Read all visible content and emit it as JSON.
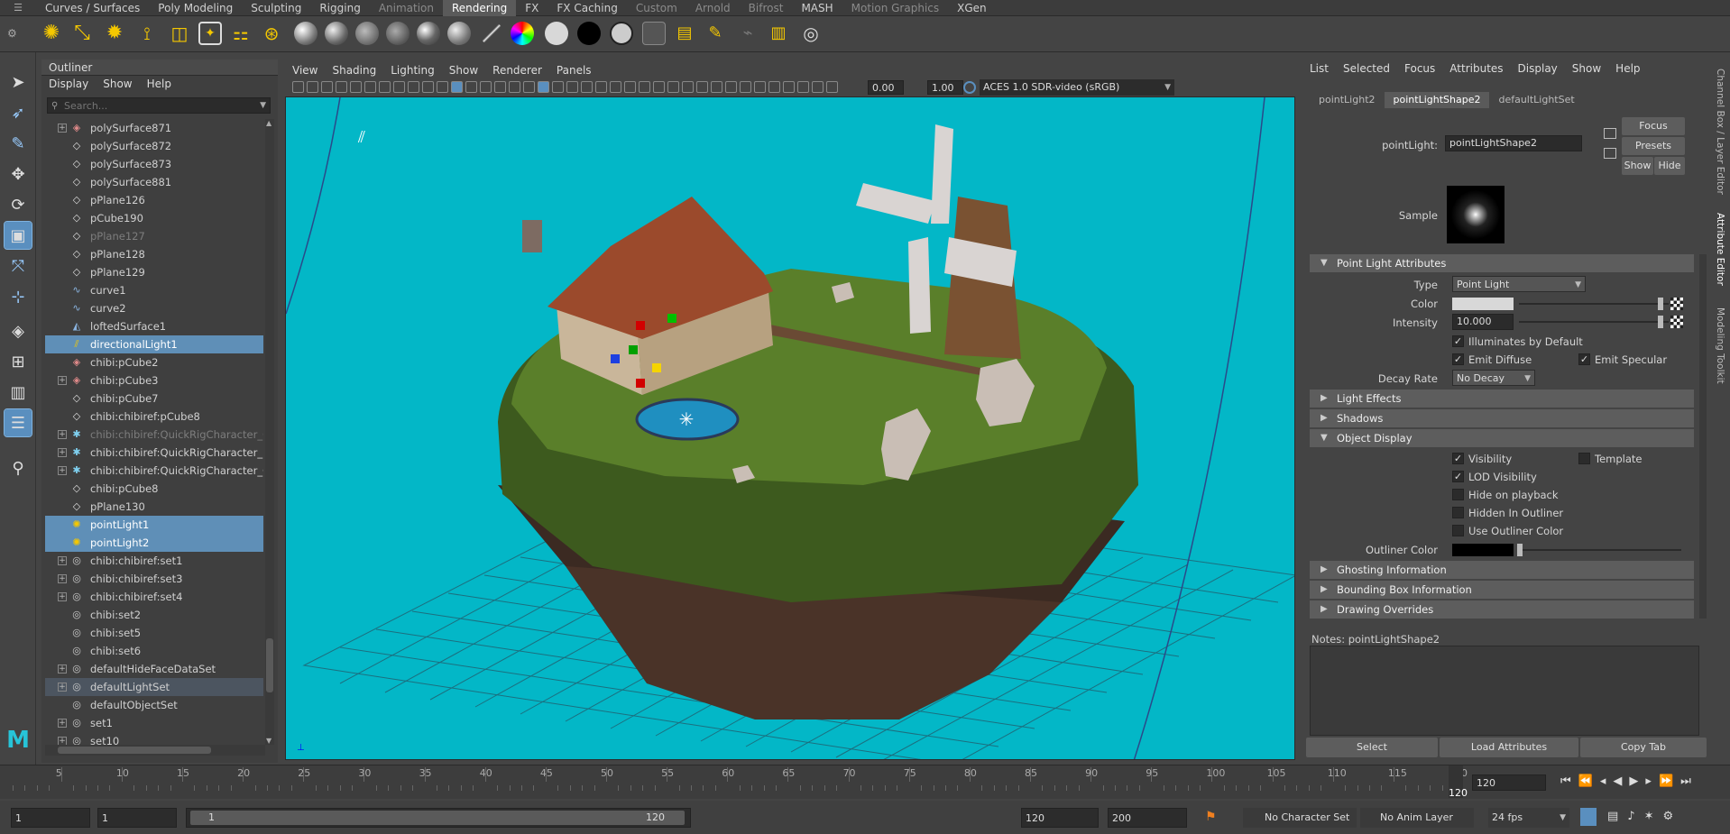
{
  "shelf": {
    "tabs": [
      {
        "label": "Curves / Surfaces",
        "dim": false
      },
      {
        "label": "Poly Modeling",
        "dim": false
      },
      {
        "label": "Sculpting",
        "dim": false
      },
      {
        "label": "Rigging",
        "dim": false
      },
      {
        "label": "Animation",
        "dim": true
      },
      {
        "label": "Rendering",
        "dim": false,
        "active": true
      },
      {
        "label": "FX",
        "dim": false
      },
      {
        "label": "FX Caching",
        "dim": false
      },
      {
        "label": "Custom",
        "dim": true
      },
      {
        "label": "Arnold",
        "dim": true
      },
      {
        "label": "Bifrost",
        "dim": true
      },
      {
        "label": "MASH",
        "dim": false
      },
      {
        "label": "Motion Graphics",
        "dim": true
      },
      {
        "label": "XGen",
        "dim": false
      }
    ]
  },
  "outliner": {
    "title": "Outliner",
    "menus": [
      "Display",
      "Show",
      "Help"
    ],
    "search_placeholder": "Search...",
    "rows": [
      {
        "label": "polySurface871",
        "icon": "poly",
        "expand": true,
        "state": ""
      },
      {
        "label": "polySurface872",
        "icon": "mesh",
        "expand": false,
        "state": ""
      },
      {
        "label": "polySurface873",
        "icon": "mesh",
        "expand": false,
        "state": ""
      },
      {
        "label": "polySurface881",
        "icon": "mesh",
        "expand": false,
        "state": ""
      },
      {
        "label": "pPlane126",
        "icon": "mesh",
        "expand": false,
        "state": ""
      },
      {
        "label": "pCube190",
        "icon": "mesh",
        "expand": false,
        "state": ""
      },
      {
        "label": "pPlane127",
        "icon": "mesh",
        "expand": false,
        "state": "dim"
      },
      {
        "label": "pPlane128",
        "icon": "mesh",
        "expand": false,
        "state": ""
      },
      {
        "label": "pPlane129",
        "icon": "mesh",
        "expand": false,
        "state": ""
      },
      {
        "label": "curve1",
        "icon": "curve",
        "expand": false,
        "state": ""
      },
      {
        "label": "curve2",
        "icon": "curve",
        "expand": false,
        "state": ""
      },
      {
        "label": "loftedSurface1",
        "icon": "surface",
        "expand": false,
        "state": ""
      },
      {
        "label": "directionalLight1",
        "icon": "dirlight",
        "expand": false,
        "state": "sel"
      },
      {
        "label": "chibi:pCube2",
        "icon": "poly",
        "expand": false,
        "state": ""
      },
      {
        "label": "chibi:pCube3",
        "icon": "poly",
        "expand": true,
        "state": ""
      },
      {
        "label": "chibi:pCube7",
        "icon": "mesh",
        "expand": false,
        "state": ""
      },
      {
        "label": "chibi:chibiref:pCube8",
        "icon": "mesh",
        "expand": false,
        "state": ""
      },
      {
        "label": "chibi:chibiref:QuickRigCharacter_Guid",
        "icon": "joint",
        "expand": true,
        "state": "dim"
      },
      {
        "label": "chibi:chibiref:QuickRigCharacter_Refe",
        "icon": "joint",
        "expand": true,
        "state": ""
      },
      {
        "label": "chibi:chibiref:QuickRigCharacter_Ctrl_",
        "icon": "joint",
        "expand": true,
        "state": ""
      },
      {
        "label": "chibi:pCube8",
        "icon": "mesh",
        "expand": false,
        "state": ""
      },
      {
        "label": "pPlane130",
        "icon": "mesh",
        "expand": false,
        "state": ""
      },
      {
        "label": "pointLight1",
        "icon": "pointlight",
        "expand": false,
        "state": "sel"
      },
      {
        "label": "pointLight2",
        "icon": "pointlight",
        "expand": false,
        "state": "sel"
      },
      {
        "label": "chibi:chibiref:set1",
        "icon": "set",
        "expand": true,
        "state": ""
      },
      {
        "label": "chibi:chibiref:set3",
        "icon": "set",
        "expand": true,
        "state": ""
      },
      {
        "label": "chibi:chibiref:set4",
        "icon": "set",
        "expand": true,
        "state": ""
      },
      {
        "label": "chibi:set2",
        "icon": "set",
        "expand": false,
        "state": ""
      },
      {
        "label": "chibi:set5",
        "icon": "set",
        "expand": false,
        "state": ""
      },
      {
        "label": "chibi:set6",
        "icon": "set",
        "expand": false,
        "state": ""
      },
      {
        "label": "defaultHideFaceDataSet",
        "icon": "set",
        "expand": true,
        "state": ""
      },
      {
        "label": "defaultLightSet",
        "icon": "set",
        "expand": true,
        "state": "hl"
      },
      {
        "label": "defaultObjectSet",
        "icon": "set",
        "expand": false,
        "state": ""
      },
      {
        "label": "set1",
        "icon": "set",
        "expand": true,
        "state": ""
      },
      {
        "label": "set10",
        "icon": "set",
        "expand": true,
        "state": ""
      }
    ]
  },
  "viewport": {
    "menus": [
      "View",
      "Shading",
      "Lighting",
      "Show",
      "Renderer",
      "Panels"
    ],
    "exposure": "0.00",
    "gamma": "1.00",
    "color_space": "ACES 1.0 SDR-video (sRGB)",
    "background": "#03b7c7"
  },
  "attribute_editor": {
    "menus": [
      "List",
      "Selected",
      "Focus",
      "Attributes",
      "Display",
      "Show",
      "Help"
    ],
    "tabs": [
      {
        "label": "pointLight2",
        "active": false
      },
      {
        "label": "pointLightShape2",
        "active": true
      },
      {
        "label": "defaultLightSet",
        "active": false
      }
    ],
    "node_label": "pointLight:",
    "node_name": "pointLightShape2",
    "buttons": {
      "focus": "Focus",
      "presets": "Presets",
      "show": "Show",
      "hide": "Hide"
    },
    "sample_label": "Sample",
    "sections": {
      "point_light": "Point Light Attributes",
      "light_effects": "Light Effects",
      "shadows": "Shadows",
      "object_display": "Object Display",
      "ghosting": "Ghosting Information",
      "bounding_box": "Bounding Box Information",
      "drawing_overrides": "Drawing Overrides"
    },
    "type_label": "Type",
    "type_value": "Point Light",
    "color_label": "Color",
    "intensity_label": "Intensity",
    "intensity_value": "10.000",
    "illuminates_default": "Illuminates by Default",
    "emit_diffuse": "Emit Diffuse",
    "emit_specular": "Emit Specular",
    "decay_label": "Decay Rate",
    "decay_value": "No Decay",
    "visibility": "Visibility",
    "template": "Template",
    "lod_visibility": "LOD Visibility",
    "hide_on_playback": "Hide on playback",
    "hidden_in_outliner": "Hidden In Outliner",
    "use_outliner_color": "Use Outliner Color",
    "outliner_color_label": "Outliner Color",
    "notes_label": "Notes:",
    "notes_node": "pointLightShape2",
    "bottom_buttons": {
      "select": "Select",
      "load": "Load Attributes",
      "copy": "Copy Tab"
    }
  },
  "side_tabs": [
    "Channel Box / Layer Editor",
    "Attribute Editor",
    "Modeling Toolkit"
  ],
  "timeline": {
    "ticks": [
      "5",
      "10",
      "15",
      "20",
      "25",
      "30",
      "35",
      "40",
      "45",
      "50",
      "55",
      "60",
      "65",
      "70",
      "75",
      "80",
      "85",
      "90",
      "95",
      "100",
      "105",
      "110",
      "115",
      "120"
    ],
    "current_frame": "120",
    "current_field": "120"
  },
  "range": {
    "start": "1",
    "playback_start": "1",
    "slider_start": "1",
    "slider_end": "120",
    "playback_end": "120",
    "end": "200",
    "character_set": "No Character Set",
    "anim_layer": "No Anim Layer",
    "fps": "24 fps"
  }
}
